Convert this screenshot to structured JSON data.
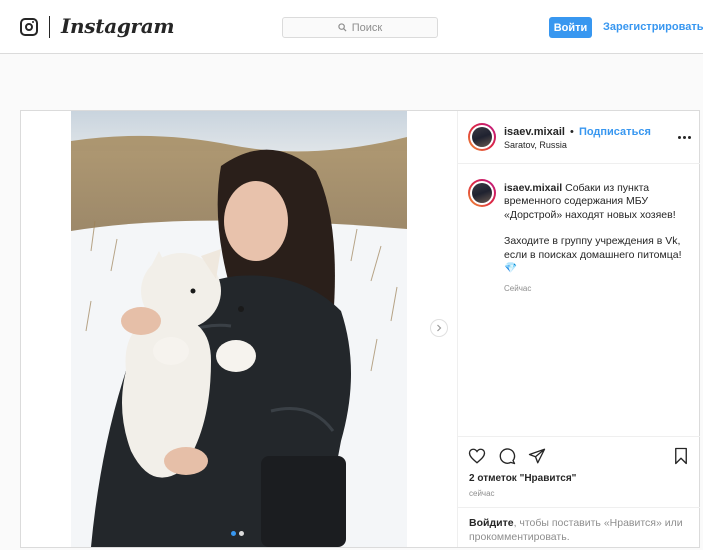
{
  "header": {
    "brand": "Instagram",
    "search_placeholder": "Поиск",
    "login_label": "Войти",
    "signup_label": "Зарегистрироваться"
  },
  "post": {
    "username": "isaev.mixail",
    "separator": "•",
    "follow_label": "Подписаться",
    "location": "Saratov, Russia",
    "caption_username": "isaev.mixail",
    "caption_p1": "Собаки из пункта временного содержания МБУ «Дорстрой» находят новых хозяев!",
    "caption_p2": "Заходите в группу учреждения в Vk, если в поисках домашнего питомца!",
    "caption_emoji": "💎",
    "caption_time": "Сейчас",
    "likes_text": "2 отметок \"Нравится\"",
    "time_ago": "сейчас",
    "login_link": "Войдите",
    "login_rest": ", чтобы поставить «Нравится» или прокомментировать.",
    "carousel": {
      "slide_count": 2,
      "active_slide": 1
    }
  },
  "icons": {
    "instagram": "instagram-glyph-icon",
    "search": "search-icon",
    "more": "more-options-icon",
    "next": "chevron-right-icon",
    "like": "heart-icon",
    "comment": "comment-icon",
    "share": "share-icon",
    "save": "bookmark-icon"
  },
  "colors": {
    "accent": "#3897f0",
    "border": "#dbdbdb",
    "muted": "#8e8e8e",
    "text": "#262626"
  }
}
